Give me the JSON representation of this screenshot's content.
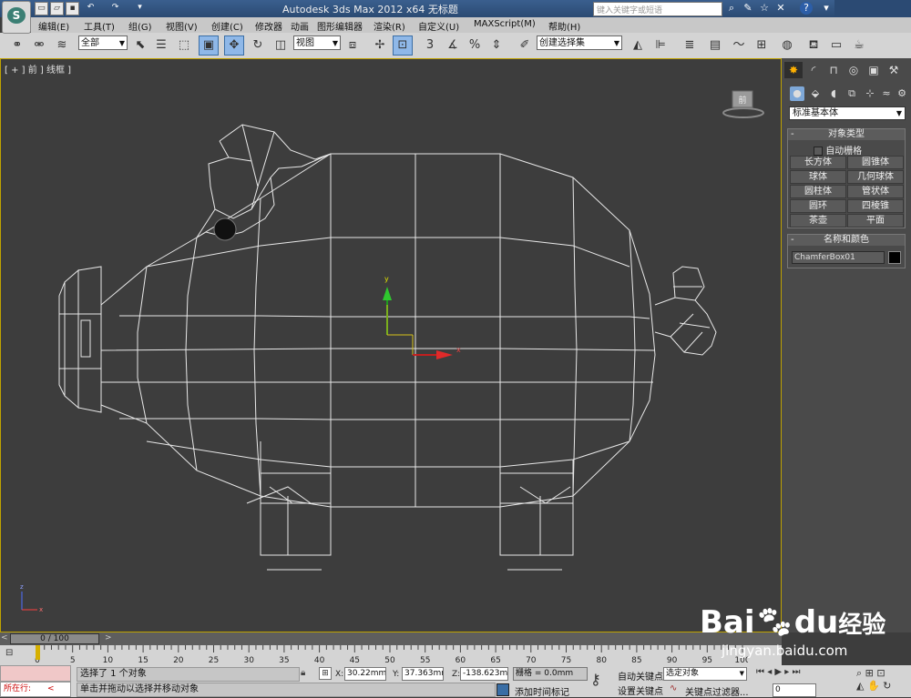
{
  "title_bar": {
    "title": "Autodesk 3ds Max  2012 x64      无标题",
    "search_placeholder": "键入关键字或短语",
    "quick_access_icons": [
      "new-icon",
      "open-icon",
      "save-icon",
      "undo-icon",
      "redo-icon",
      "customize-icon"
    ],
    "help_label": "?"
  },
  "menu": {
    "items": [
      "编辑(E)",
      "工具(T)",
      "组(G)",
      "视图(V)",
      "创建(C)",
      "修改器",
      "动画",
      "图形编辑器",
      "渲染(R)",
      "自定义(U)",
      "MAXScript(M)",
      "帮助(H)"
    ]
  },
  "toolbar": {
    "selection_filter": "全部",
    "reference_coord": "视图",
    "named_selection_set": "创建选择集"
  },
  "viewport": {
    "label": "[ + ] 前 ] 线框 ]",
    "viewcube_label": "前",
    "axis_labels": {
      "y": "y",
      "x": "x",
      "z": "z"
    }
  },
  "command_panel": {
    "category": "标准基本体",
    "object_type": {
      "title": "对象类型",
      "autogrid_label": "自动栅格",
      "buttons": [
        "长方体",
        "圆锥体",
        "球体",
        "几何球体",
        "圆柱体",
        "管状体",
        "圆环",
        "四棱锥",
        "茶壶",
        "平面"
      ]
    },
    "name_and_color": {
      "title": "名称和颜色",
      "object_name": "ChamferBox01",
      "color": "#000000"
    }
  },
  "timeline": {
    "slider_label": "0 / 100",
    "ticks": [
      "0",
      "5",
      "10",
      "15",
      "20",
      "25",
      "30",
      "35",
      "40",
      "45",
      "50",
      "55",
      "60",
      "65",
      "70",
      "75",
      "80",
      "85",
      "90",
      "95",
      "100"
    ]
  },
  "status": {
    "running_label": "所在行:",
    "selection_text": "选择了 1 个对象",
    "prompt_text": "单击并拖动以选择并移动对象",
    "x_label": "X:",
    "x_value": "30.22mm",
    "y_label": "Y:",
    "y_value": "37.363mm",
    "z_label": "Z:",
    "z_value": "-138.623m",
    "grid_text": "栅格 = 0.0mm",
    "add_time_tag": "添加时间标记",
    "auto_key": "自动关键点",
    "set_key": "设置关键点",
    "selected_dropdown": "选定对象",
    "key_filters": "关键点过滤器...",
    "frame_value": "0"
  },
  "watermark": {
    "brand": "Bai",
    "brand2": "du",
    "brand_cn": "经验",
    "url": "jingyan.baidu.com"
  }
}
